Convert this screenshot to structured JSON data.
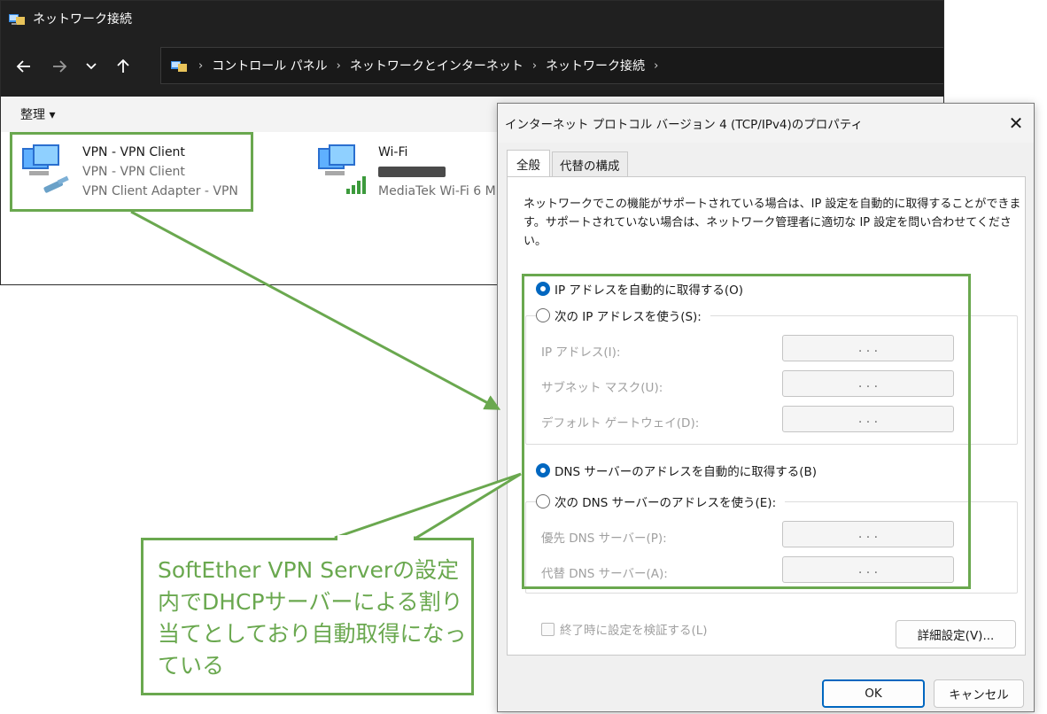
{
  "explorer": {
    "title": "ネットワーク接続",
    "breadcrumb": [
      "コントロール パネル",
      "ネットワークとインターネット",
      "ネットワーク接続"
    ],
    "toolbar": {
      "organize_label": "整理 ▾"
    },
    "items": [
      {
        "name": "VPN - VPN Client",
        "line2": "VPN - VPN Client",
        "line3": "VPN Client Adapter - VPN"
      },
      {
        "name": "Wi-Fi",
        "line3": "MediaTek Wi-Fi 6 M"
      }
    ]
  },
  "dialog": {
    "title": "インターネット プロトコル バージョン 4 (TCP/IPv4)のプロパティ",
    "close_glyph": "✕",
    "tabs": [
      "全般",
      "代替の構成"
    ],
    "description": "ネットワークでこの機能がサポートされている場合は、IP 設定を自動的に取得することができます。サポートされていない場合は、ネットワーク管理者に適切な IP 設定を問い合わせてください。",
    "ip": {
      "auto_label": "IP アドレスを自動的に取得する(O)",
      "manual_label": "次の IP アドレスを使う(S):",
      "selected": "auto",
      "fields": [
        {
          "label": "IP アドレス(I):",
          "value": ".      .      ."
        },
        {
          "label": "サブネット マスク(U):",
          "value": ".      .      ."
        },
        {
          "label": "デフォルト ゲートウェイ(D):",
          "value": ".      .      ."
        }
      ]
    },
    "dns": {
      "auto_label": "DNS サーバーのアドレスを自動的に取得する(B)",
      "manual_label": "次の DNS サーバーのアドレスを使う(E):",
      "selected": "auto",
      "fields": [
        {
          "label": "優先 DNS サーバー(P):",
          "value": ".      .      ."
        },
        {
          "label": "代替 DNS サーバー(A):",
          "value": ".      .      ."
        }
      ]
    },
    "validate_label": "終了時に設定を検証する(L)",
    "advanced_label": "詳細設定(V)...",
    "ok_label": "OK",
    "cancel_label": "キャンセル"
  },
  "callout": {
    "text": "SoftEther VPN Serverの設定内でDHCPサーバーによる割り当てとしており自動取得になっている"
  },
  "colors": {
    "accent_green": "#6aa84f",
    "radio_blue": "#0067c0",
    "titlebar_dark": "#202020"
  },
  "icons": [
    "network-folder-icon",
    "back-arrow-icon",
    "forward-arrow-icon",
    "chevron-down-icon",
    "up-arrow-icon",
    "vpn-adapter-icon",
    "wifi-adapter-icon",
    "close-icon"
  ]
}
